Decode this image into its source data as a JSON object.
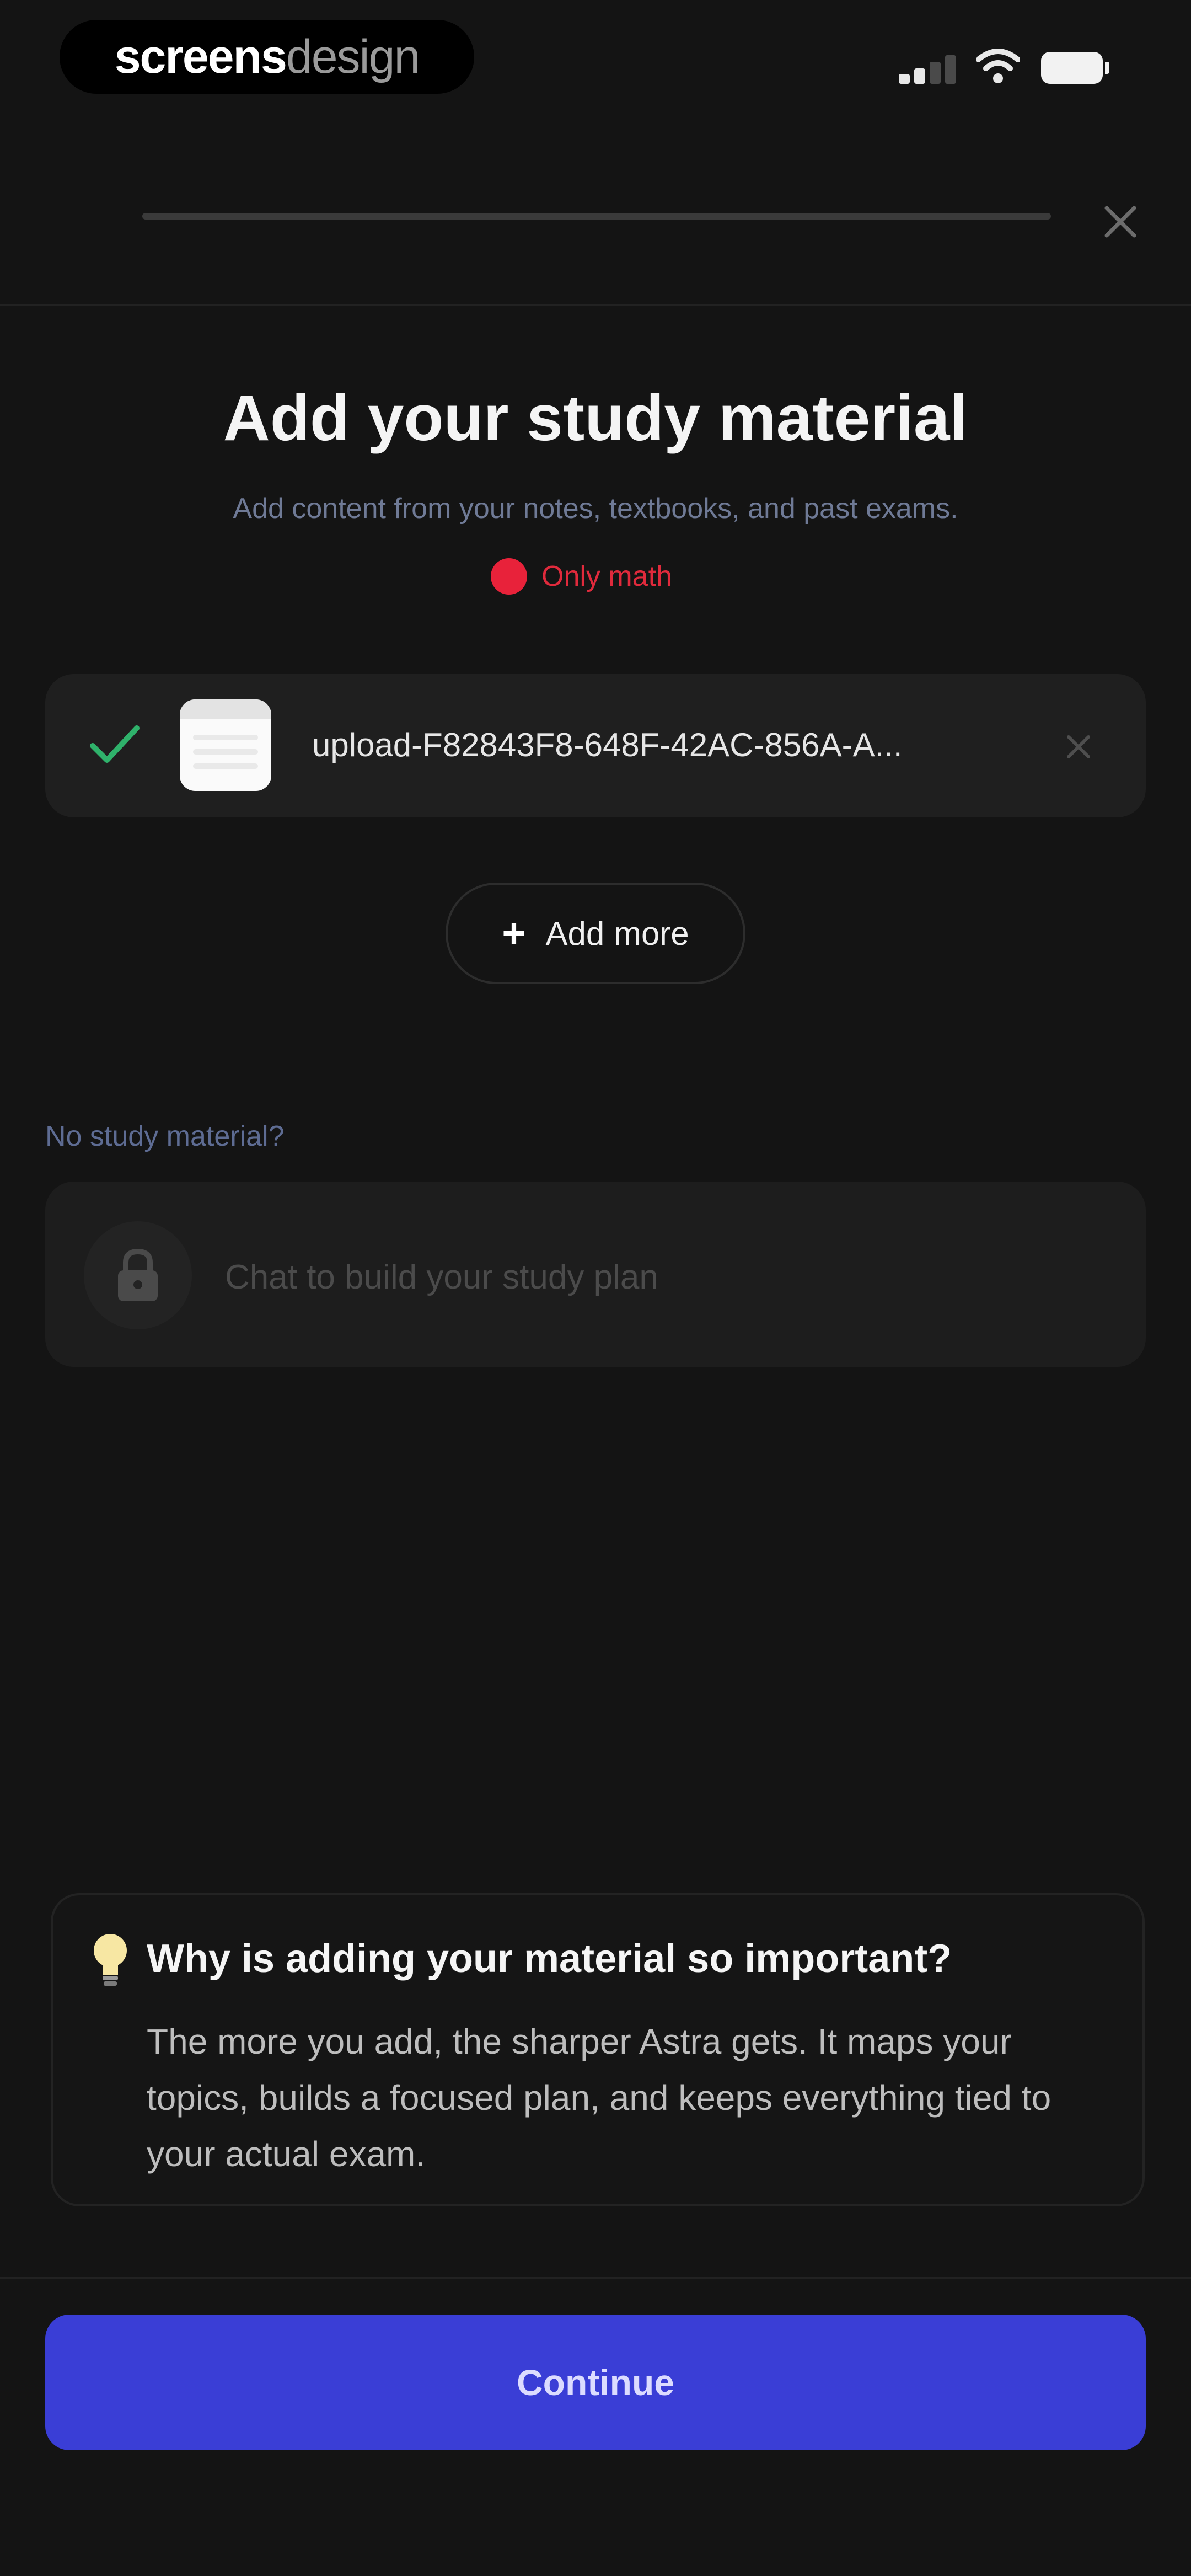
{
  "status_bar": {
    "brand_part1": "screens",
    "brand_part2": "design"
  },
  "header": {
    "close_icon": "close-icon"
  },
  "main": {
    "title": "Add your study material",
    "subtitle": "Add content from your notes, textbooks, and past exams.",
    "tag_label": "Only math",
    "tag_color": "#e8223a"
  },
  "upload": {
    "file_name": "upload-F82843F8-648F-42AC-856A-A...",
    "status_icon": "check-icon",
    "status_color": "#2fb26b",
    "add_more_label": "Add more"
  },
  "alternative": {
    "prompt": "No study material?",
    "chat_label": "Chat to build your study plan",
    "chat_icon": "lock-icon"
  },
  "info": {
    "icon": "lightbulb-icon",
    "title": "Why is adding your material so important?",
    "body": "The more you add, the sharper Astra gets. It maps your topics, builds a focused plan, and keeps everything tied to your actual exam."
  },
  "footer": {
    "continue_label": "Continue",
    "accent": "#3a3ed6"
  }
}
